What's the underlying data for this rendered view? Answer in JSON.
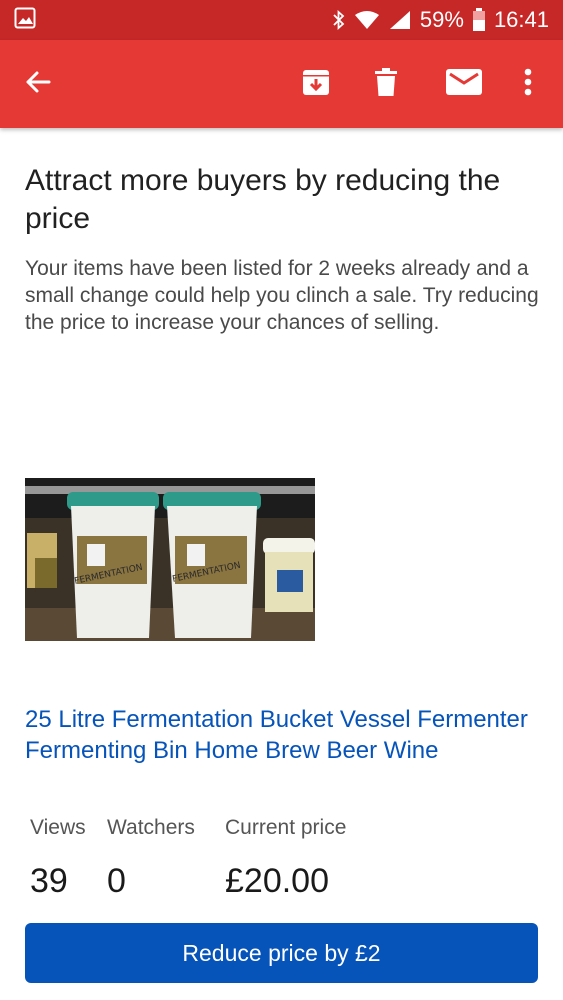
{
  "status_bar": {
    "battery": "59%",
    "time": "16:41",
    "icons": [
      "image-notification-icon",
      "bluetooth-icon",
      "wifi-icon",
      "signal-icon",
      "battery-icon"
    ]
  },
  "app_bar": {
    "icons": [
      "back-arrow-icon",
      "archive-icon",
      "delete-icon",
      "mail-icon",
      "more-vert-icon"
    ]
  },
  "email": {
    "headline": "Attract more buyers by reducing the price",
    "intro": "Your items have been listed for 2 weeks already and a small change could help you clinch a sale. Try reducing the price to increase your chances of selling.",
    "product": {
      "title": "25 Litre Fermentation Bucket Vessel Fermenter Fermenting Bin Home Brew Beer Wine",
      "image_text": "FERMENTATION"
    },
    "stats": {
      "views_label": "Views",
      "views_value": "39",
      "watchers_label": "Watchers",
      "watchers_value": "0",
      "price_label": "Current price",
      "price_value": "£20.00"
    },
    "cta_label": "Reduce price by £2"
  },
  "colors": {
    "status_bar": "#c62828",
    "app_bar": "#e53935",
    "link": "#0654ba",
    "button": "#0654ba"
  }
}
